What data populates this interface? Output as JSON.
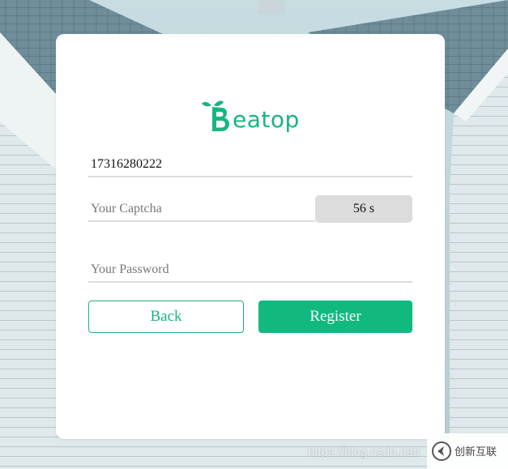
{
  "brand": {
    "logo_text": "eatop",
    "logo_letter": "B",
    "accent_color": "#17b57f"
  },
  "form": {
    "phone_value": "17316280222",
    "captcha_placeholder": "Your Captcha",
    "countdown_label": "56 s",
    "password_placeholder": "Your Password"
  },
  "buttons": {
    "back_label": "Back",
    "register_label": "Register",
    "register_color": "#11b97f"
  },
  "watermark": {
    "text": "https://blog.csdn.net/",
    "corner_logo": "创新互联"
  }
}
